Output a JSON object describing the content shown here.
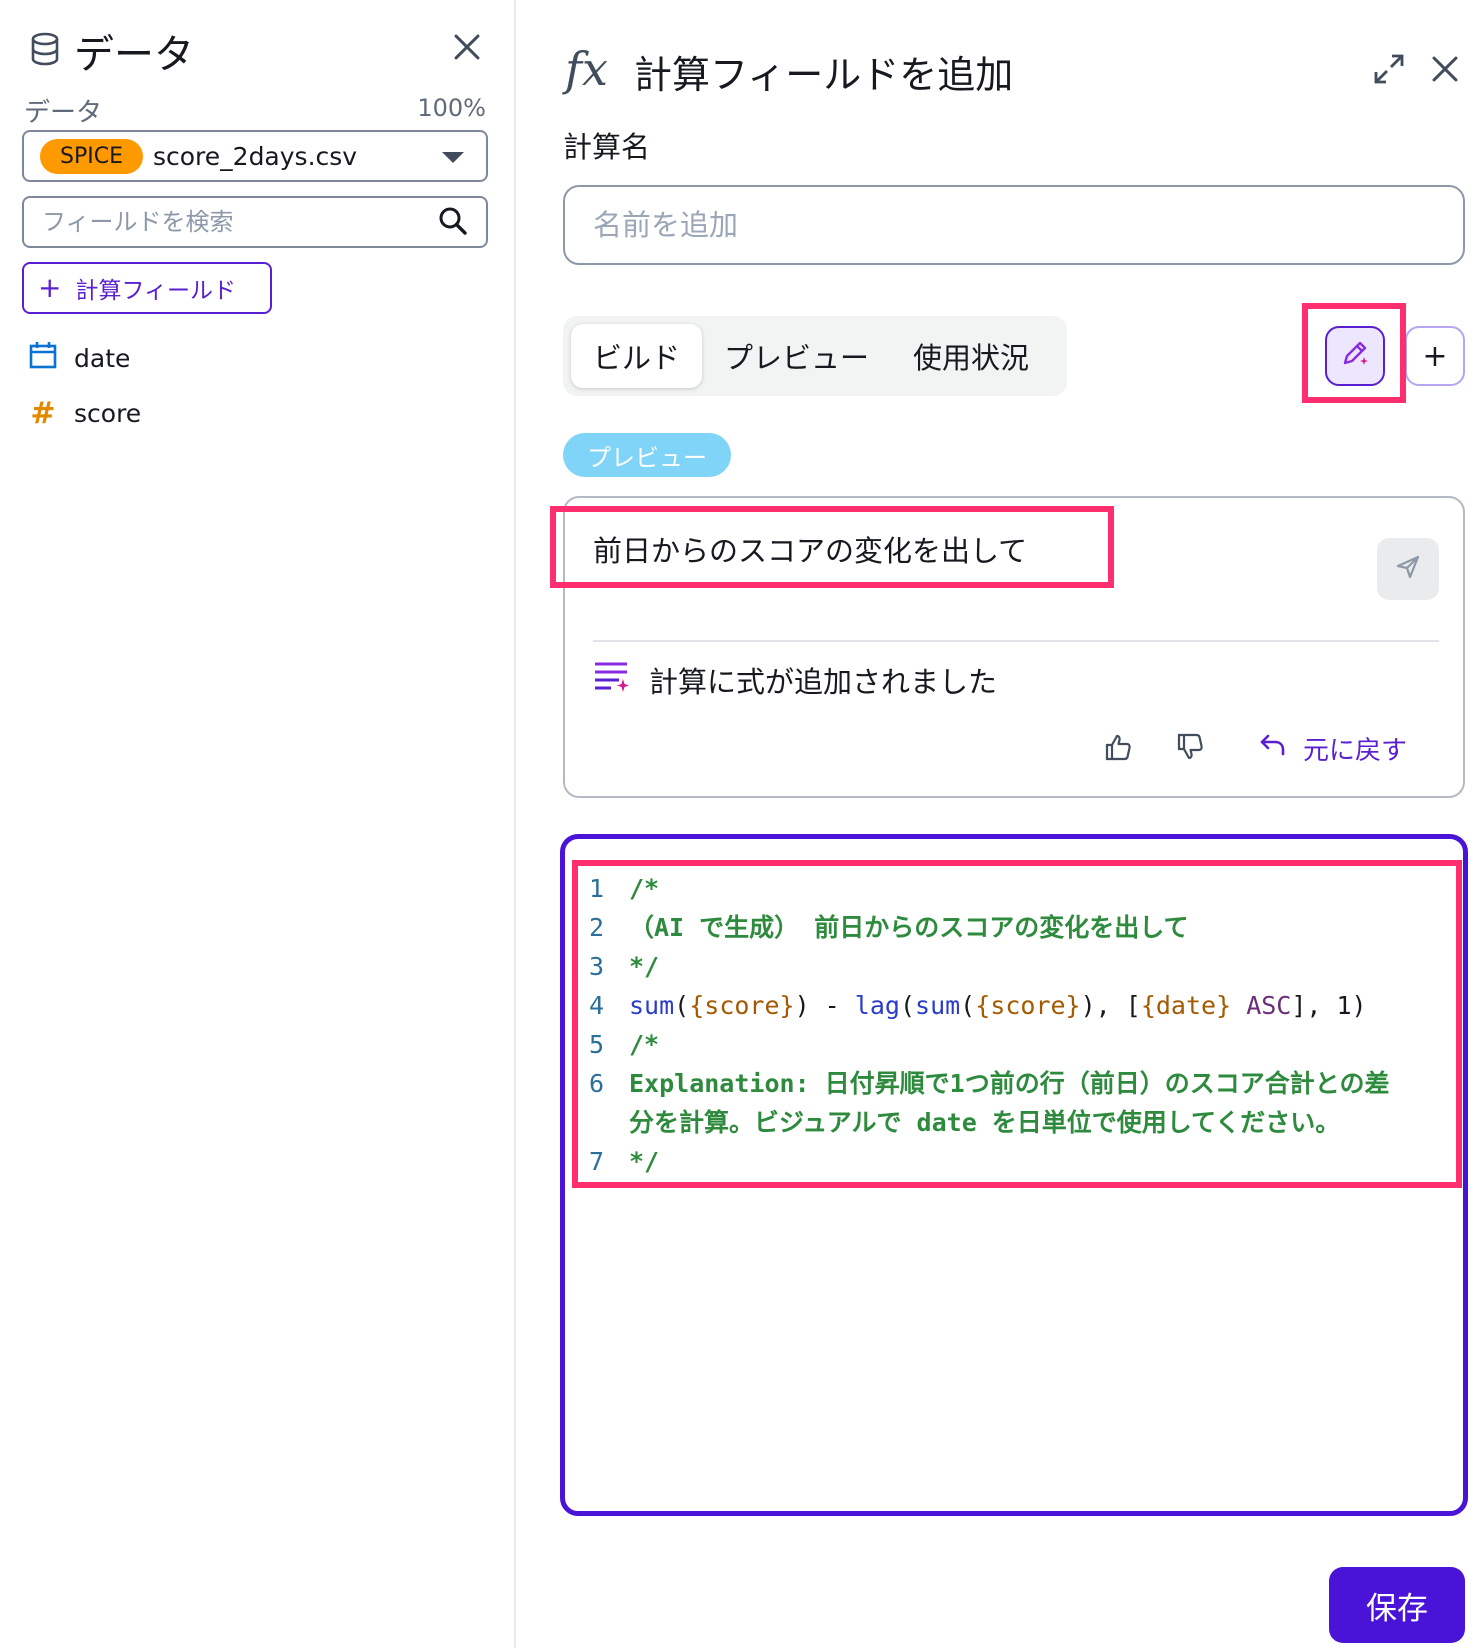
{
  "data_panel": {
    "title": "データ",
    "dataset_label": "データ",
    "dataset_percent": "100%",
    "spice_badge": "SPICE",
    "dataset_name": "score_2days.csv",
    "search_placeholder": "フィールドを検索",
    "add_calc_button": "計算フィールド",
    "fields": [
      {
        "name": "date",
        "icon": "calendar-icon"
      },
      {
        "name": "score",
        "icon": "hash-icon"
      }
    ]
  },
  "calc_panel": {
    "icon_text": "fx",
    "title": "計算フィールドを追加",
    "name_label": "計算名",
    "name_placeholder": "名前を追加",
    "tabs": [
      "ビルド",
      "プレビュー",
      "使用状況"
    ],
    "active_tab": "ビルド",
    "preview_badge": "プレビュー",
    "prompt_text": "前日からのスコアの変化を出して",
    "status_text": "計算に式が追加されました",
    "undo_label": "元に戻す",
    "save_label": "保存"
  },
  "code_editor": {
    "lines": [
      {
        "num": "1",
        "text": "/*"
      },
      {
        "num": "2",
        "text": "（AI で生成） 前日からのスコアの変化を出して"
      },
      {
        "num": "3",
        "text": "*/"
      },
      {
        "num": "4",
        "text": "sum({score}) - lag(sum({score}), [{date} ASC], 1)"
      },
      {
        "num": "5",
        "text": "/*"
      },
      {
        "num": "6",
        "text": "Explanation: 日付昇順で1つ前の行（前日）のスコア合計との差"
      },
      {
        "num": "",
        "text": "分を計算。ビジュアルで date を日単位で使用してください。"
      },
      {
        "num": "7",
        "text": "*/"
      }
    ]
  },
  "colors": {
    "accent": "#5a1fd0",
    "editor_border": "#4a14d8",
    "highlight": "#ff2e6e",
    "spice": "#ff9900",
    "preview_badge": "#7fd4f7",
    "comment": "#2e8b3e"
  }
}
